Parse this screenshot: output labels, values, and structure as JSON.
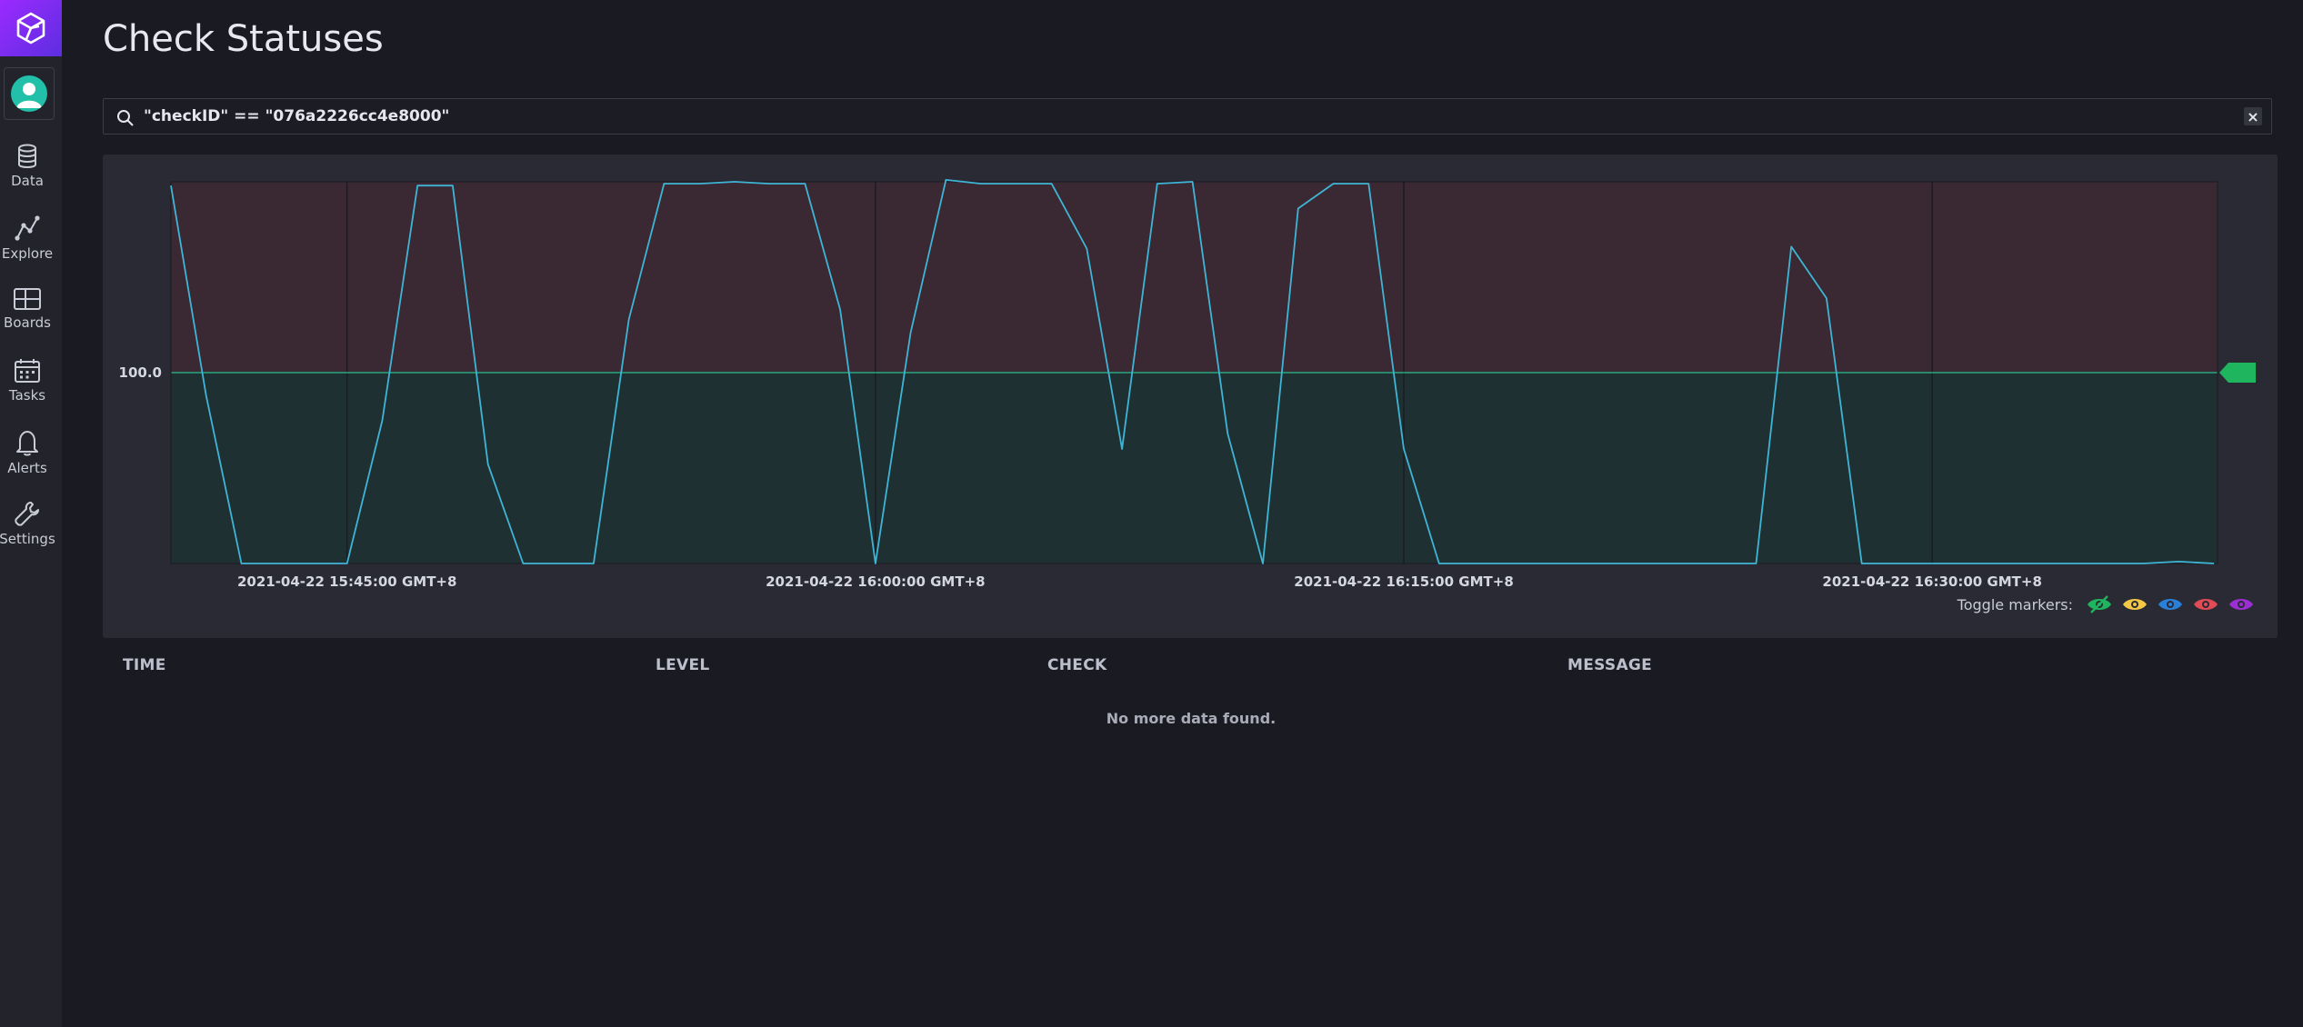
{
  "app": {
    "page_title": "Check Statuses"
  },
  "sidebar": {
    "items": [
      {
        "label": "Data",
        "icon": "database-icon"
      },
      {
        "label": "Explore",
        "icon": "graph-icon"
      },
      {
        "label": "Boards",
        "icon": "dashboard-icon"
      },
      {
        "label": "Tasks",
        "icon": "calendar-icon"
      },
      {
        "label": "Alerts",
        "icon": "bell-icon"
      },
      {
        "label": "Settings",
        "icon": "wrench-icon"
      }
    ]
  },
  "search": {
    "value": "\"checkID\" == \"076a2226cc4e8000\"",
    "clear_label": "×"
  },
  "chart_data": {
    "type": "line",
    "threshold": 100.0,
    "threshold_label": "100.0",
    "x_ticks": [
      "2021-04-22 15:45:00 GMT+8",
      "2021-04-22 16:00:00 GMT+8",
      "2021-04-22 16:15:00 GMT+8",
      "2021-04-22 16:30:00 GMT+8"
    ],
    "x_tick_minutes": [
      15,
      30,
      45,
      60
    ],
    "x_range_minutes": [
      10,
      68.1
    ],
    "y_range": [
      0,
      200
    ],
    "series": [
      {
        "color": "#3fb5d6",
        "points": [
          [
            10,
            198
          ],
          [
            11,
            88
          ],
          [
            12,
            0
          ],
          [
            13,
            0
          ],
          [
            14,
            0
          ],
          [
            15,
            0
          ],
          [
            16,
            75
          ],
          [
            17,
            198
          ],
          [
            18,
            198
          ],
          [
            19,
            52
          ],
          [
            20,
            0
          ],
          [
            21,
            0
          ],
          [
            22,
            0
          ],
          [
            23,
            128
          ],
          [
            24,
            199
          ],
          [
            25,
            199
          ],
          [
            26,
            200
          ],
          [
            27,
            199
          ],
          [
            28,
            199
          ],
          [
            29,
            133
          ],
          [
            30,
            0
          ],
          [
            31,
            121
          ],
          [
            32,
            201
          ],
          [
            33,
            199
          ],
          [
            34,
            199
          ],
          [
            35,
            199
          ],
          [
            36,
            165
          ],
          [
            37,
            60
          ],
          [
            38,
            199
          ],
          [
            39,
            200
          ],
          [
            40,
            68
          ],
          [
            41,
            0
          ],
          [
            42,
            186
          ],
          [
            43,
            199
          ],
          [
            44,
            199
          ],
          [
            45,
            60
          ],
          [
            46,
            0
          ],
          [
            47,
            0
          ],
          [
            48,
            0
          ],
          [
            49,
            0
          ],
          [
            50,
            0
          ],
          [
            51,
            0
          ],
          [
            52,
            0
          ],
          [
            53,
            0
          ],
          [
            54,
            0
          ],
          [
            55,
            0
          ],
          [
            56,
            166
          ],
          [
            57,
            139
          ],
          [
            58,
            0
          ],
          [
            59,
            0
          ],
          [
            60,
            0
          ],
          [
            61,
            0
          ],
          [
            62,
            0
          ],
          [
            63,
            0
          ],
          [
            64,
            0
          ],
          [
            65,
            0
          ],
          [
            66,
            0
          ],
          [
            67,
            1
          ],
          [
            68,
            0
          ]
        ]
      }
    ],
    "colors": {
      "crit_zone": "#3a2833",
      "ok_zone": "#1f3033",
      "threshold_line": "#27a77c",
      "handle": "#1fb45e"
    }
  },
  "markers": {
    "label": "Toggle markers:",
    "items": [
      {
        "name": "ok",
        "color": "#1fb45e",
        "hidden": true
      },
      {
        "name": "warn",
        "color": "#f2c745"
      },
      {
        "name": "info",
        "color": "#2a80d8"
      },
      {
        "name": "crit",
        "color": "#e04b55"
      },
      {
        "name": "unknown",
        "color": "#9b2fd4"
      }
    ]
  },
  "table": {
    "columns": [
      "TIME",
      "LEVEL",
      "CHECK",
      "MESSAGE"
    ],
    "empty_message": "No more data found."
  }
}
